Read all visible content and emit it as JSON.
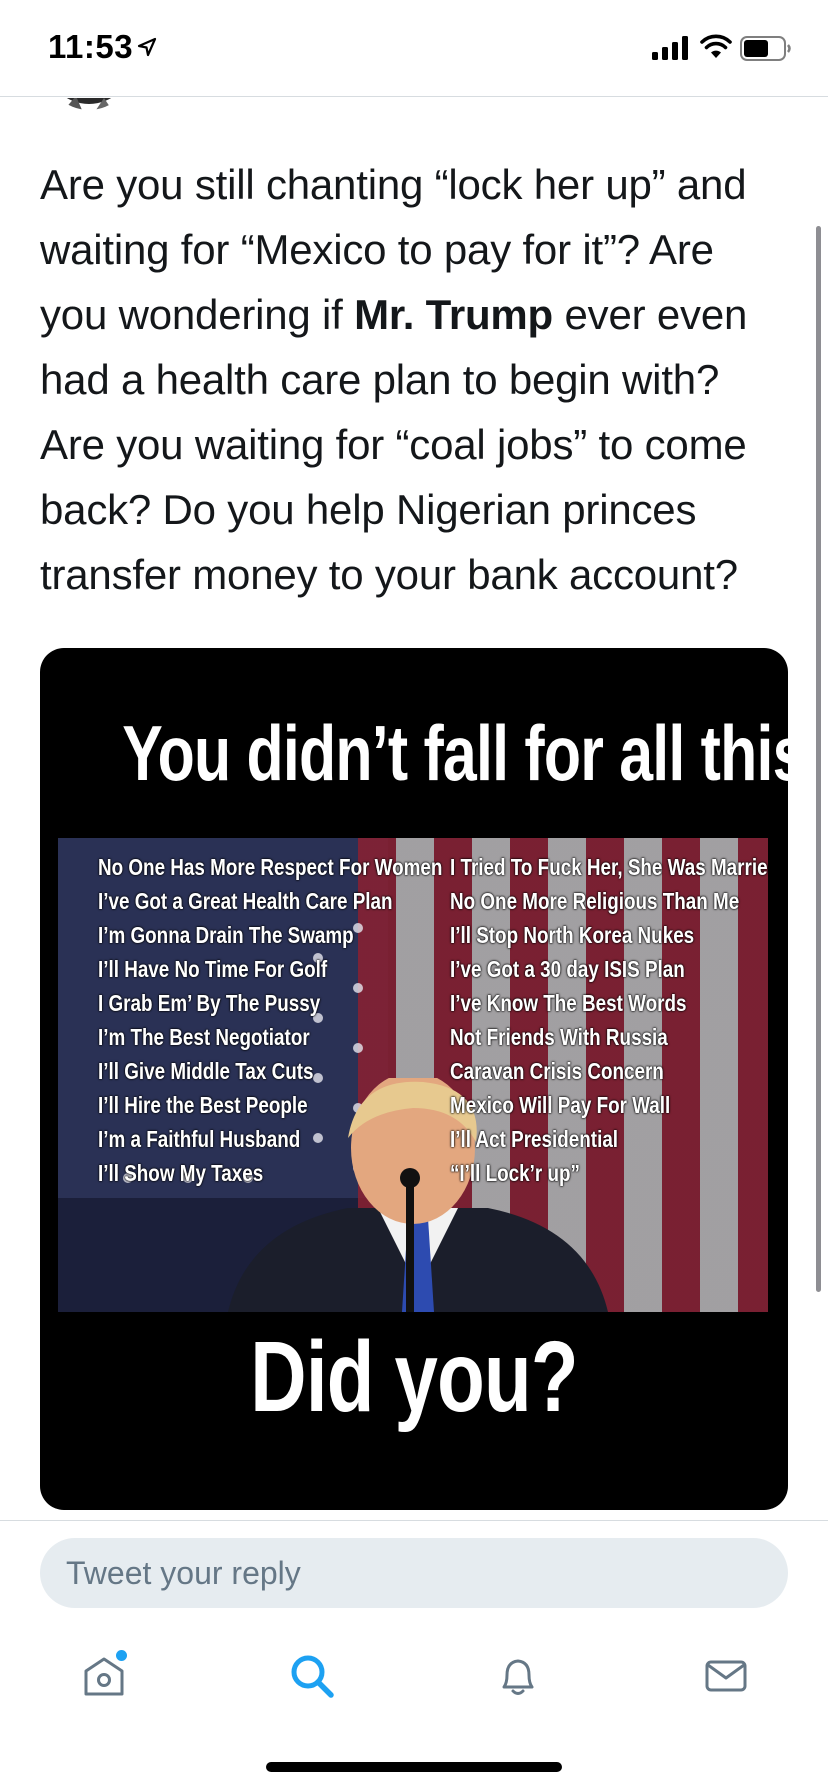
{
  "status_bar": {
    "time": "11:53",
    "icons": [
      "location-arrow-icon",
      "cellular-signal-icon",
      "wifi-icon",
      "battery-icon"
    ]
  },
  "tweet": {
    "text_before_bold": "Are you still chanting “lock her up” and waiting for “Mexico to pay for it”? Are you wondering if ",
    "bold_text": "Mr. Trump",
    "text_after_bold": " ever even had a health care plan to begin with? Are you waiting for “coal jobs” to come back? Do you help Nigerian princes transfer money to your bank account?"
  },
  "media": {
    "headline": "You didn’t fall for all this?",
    "left_list": [
      "No One Has More Respect For Women",
      "I’ve Got a Great Health Care Plan",
      "I’m Gonna Drain The Swamp",
      "I’ll Have No Time For Golf",
      "I Grab Em’ By The Pussy",
      "I’m The Best Negotiator",
      "I’ll Give Middle Tax Cuts",
      "I’ll Hire the Best People",
      "I’m a Faithful Husband",
      "I’ll Show My Taxes"
    ],
    "right_list": [
      "I Tried To Fuck Her, She Was Married",
      "No One More Religious Than Me",
      "I’ll Stop North Korea Nukes",
      "I’ve Got a 30 day ISIS Plan",
      "I’ve Know The Best Words",
      "Not Friends With Russia",
      "Caravan Crisis Concern",
      "Mexico Will Pay For Wall",
      "I’ll Act Presidential",
      "“I’ll Lock’r up”"
    ],
    "footer": "Did you?"
  },
  "reply": {
    "placeholder": "Tweet your reply"
  },
  "tabbar": {
    "items": [
      "home-icon",
      "search-icon",
      "notifications-bell-icon",
      "messages-envelope-icon"
    ],
    "active": "search-icon",
    "accent_color": "#1da1f2",
    "inactive_color": "#657786"
  }
}
